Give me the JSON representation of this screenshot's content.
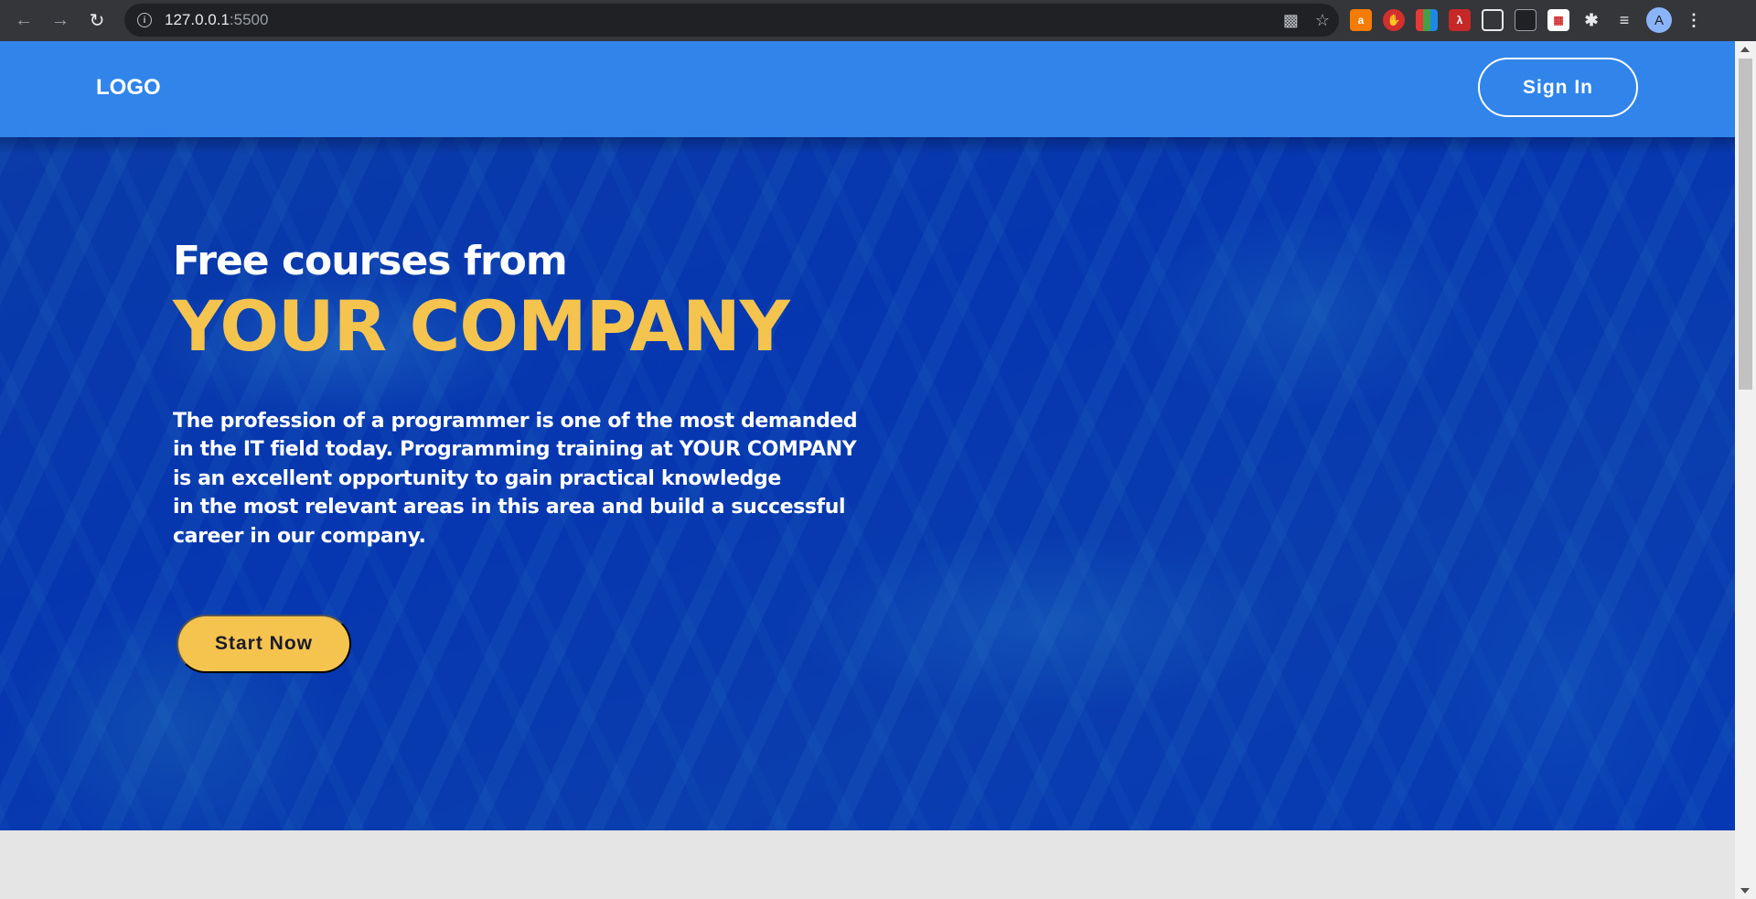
{
  "browser": {
    "url_host": "127.0.0.1",
    "url_port": ":5500",
    "avatar_letter": "A"
  },
  "header": {
    "logo": "LOGO",
    "signin_label": "Sign In"
  },
  "hero": {
    "subtitle": "Free courses from",
    "title": "YOUR COMPANY",
    "description_lines": [
      "The profession of a programmer is one of the most demanded",
      "in the IT field today. Programming training at YOUR COMPANY",
      "is an excellent opportunity to gain practical knowledge",
      "in the most relevant areas in this area and build a successful",
      "career in our company."
    ],
    "cta_label": "Start Now"
  },
  "colors": {
    "header_bg": "#3084ea",
    "hero_bg": "#0a3ba8",
    "accent": "#f4c44f",
    "footer_bg": "#e5e5e5"
  }
}
